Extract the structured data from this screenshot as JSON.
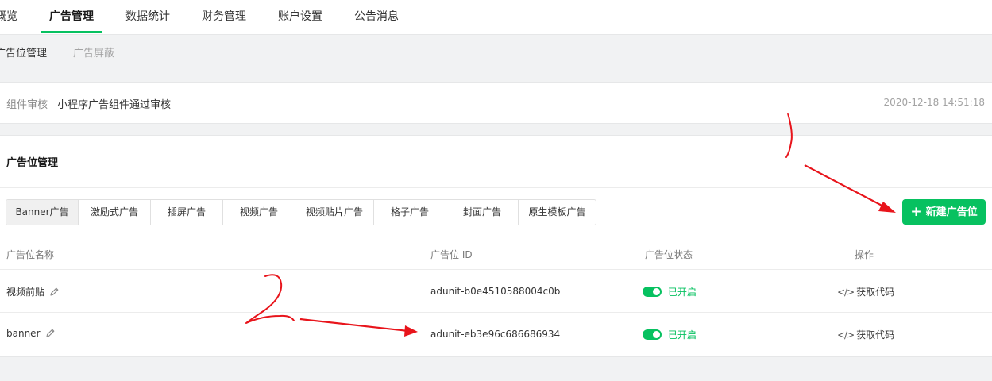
{
  "top_nav": [
    "概览",
    "广告管理",
    "数据统计",
    "财务管理",
    "账户设置",
    "公告消息"
  ],
  "sub_nav": [
    "广告位管理",
    "广告屏蔽"
  ],
  "notice": {
    "label": "组件审核",
    "message": "小程序广告组件通过审核",
    "time": "2020-12-18 14:51:18"
  },
  "panel": {
    "title": "广告位管理",
    "tabs": [
      "Banner广告",
      "激励式广告",
      "插屏广告",
      "视频广告",
      "视频贴片广告",
      "格子广告",
      "封面广告",
      "原生模板广告"
    ],
    "new_button": "新建广告位",
    "columns": [
      "广告位名称",
      "广告位 ID",
      "广告位状态",
      "操作"
    ],
    "rows": [
      {
        "name": "视频前贴",
        "id": "adunit-b0e4510588004c0b",
        "status": "已开启",
        "action": "获取代码"
      },
      {
        "name": "banner",
        "id": "adunit-eb3e96c686686934",
        "status": "已开启",
        "action": "获取代码"
      }
    ]
  },
  "annotation_color": "#e8141b",
  "accent_color": "#07c160"
}
